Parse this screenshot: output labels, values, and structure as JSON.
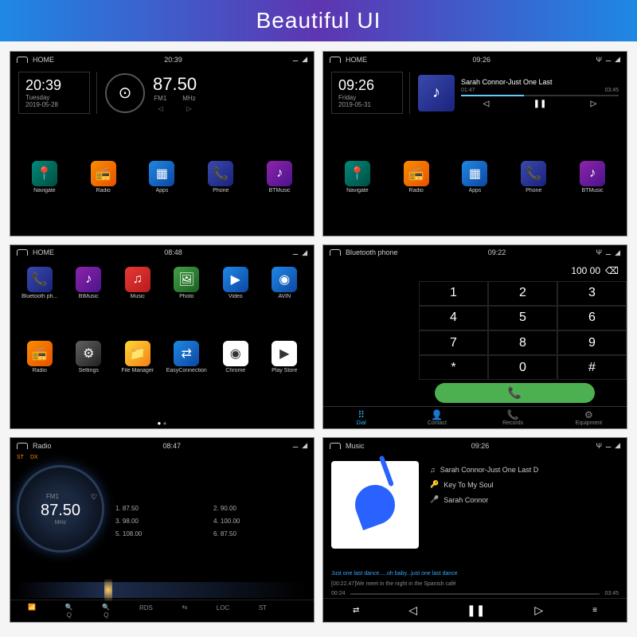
{
  "header": "Beautiful UI",
  "p1": {
    "bar_label": "HOME",
    "bar_time": "20:39",
    "clock": {
      "time": "20:39",
      "day": "Tuesday",
      "date": "2019-05-28"
    },
    "radio": {
      "freq": "87.50",
      "band": "FM1",
      "unit": "MHz"
    },
    "apps": [
      {
        "label": "Navigate",
        "icon": "📍",
        "cls": "teal"
      },
      {
        "label": "Radio",
        "icon": "📻",
        "cls": "orange"
      },
      {
        "label": "Apps",
        "icon": "▦",
        "cls": "blue"
      },
      {
        "label": "Phone",
        "icon": "📞",
        "cls": "navy"
      },
      {
        "label": "BTMusic",
        "icon": "♪",
        "cls": "purple"
      }
    ]
  },
  "p2": {
    "bar_label": "HOME",
    "bar_time": "09:26",
    "clock": {
      "time": "09:26",
      "day": "Friday",
      "date": "2019-05-31"
    },
    "music": {
      "title": "Sarah Connor-Just One Last",
      "t1": "01:47",
      "t2": "03:45"
    },
    "apps": [
      {
        "label": "Navigate",
        "icon": "📍",
        "cls": "teal"
      },
      {
        "label": "Radio",
        "icon": "📻",
        "cls": "orange"
      },
      {
        "label": "Apps",
        "icon": "▦",
        "cls": "blue"
      },
      {
        "label": "Phone",
        "icon": "📞",
        "cls": "navy"
      },
      {
        "label": "BTMusic",
        "icon": "♪",
        "cls": "purple"
      }
    ]
  },
  "p3": {
    "bar_label": "HOME",
    "bar_time": "08:48",
    "apps": [
      {
        "label": "Bluetooth ph...",
        "icon": "📞",
        "cls": "navy"
      },
      {
        "label": "BtMusic",
        "icon": "♪",
        "cls": "purple"
      },
      {
        "label": "Music",
        "icon": "♫",
        "cls": "red"
      },
      {
        "label": "Photo",
        "icon": "🖼",
        "cls": "green"
      },
      {
        "label": "Video",
        "icon": "▶",
        "cls": "blue"
      },
      {
        "label": "AVIN",
        "icon": "◉",
        "cls": "blue"
      },
      {
        "label": "Radio",
        "icon": "📻",
        "cls": "orange"
      },
      {
        "label": "Settings",
        "icon": "⚙",
        "cls": "grey"
      },
      {
        "label": "File Manager",
        "icon": "📁",
        "cls": "yellow"
      },
      {
        "label": "EasyConnection",
        "icon": "⇄",
        "cls": "blue"
      },
      {
        "label": "Chrome",
        "icon": "◉",
        "cls": "white"
      },
      {
        "label": "Play Store",
        "icon": "▶",
        "cls": "white"
      }
    ]
  },
  "p4": {
    "bar_label": "Bluetooth phone",
    "bar_time": "09:22",
    "display": "100 00",
    "keys": [
      "1",
      "2",
      "3",
      "4",
      "5",
      "6",
      "7",
      "8",
      "9",
      "*",
      "0",
      "#"
    ],
    "tabs": [
      {
        "label": "Dial",
        "icon": "⠿"
      },
      {
        "label": "Contact",
        "icon": "👤"
      },
      {
        "label": "Records",
        "icon": "📞"
      },
      {
        "label": "Equipment",
        "icon": "⚙"
      }
    ]
  },
  "p5": {
    "bar_label": "Radio",
    "bar_time": "08:47",
    "st": "ST",
    "dx": "DX",
    "band": "FM1",
    "freq": "87.50",
    "unit": "MHz",
    "presets": [
      {
        "n": "1.",
        "f": "87.50"
      },
      {
        "n": "2.",
        "f": "90.00"
      },
      {
        "n": "3.",
        "f": "98.00"
      },
      {
        "n": "4.",
        "f": "100.00"
      },
      {
        "n": "5.",
        "f": "108.00"
      },
      {
        "n": "6.",
        "f": "87.50"
      }
    ],
    "btns": [
      "",
      "Q",
      "Q",
      "RDS",
      "",
      "LOC",
      "ST",
      ""
    ]
  },
  "p6": {
    "bar_label": "Music",
    "bar_time": "09:26",
    "tracks": [
      {
        "icon": "♫",
        "label": "Sarah Connor-Just One Last D"
      },
      {
        "icon": "🔑",
        "label": "Key To My Soul"
      },
      {
        "icon": "🎤",
        "label": "Sarah Connor"
      }
    ],
    "lyrics1": "Just one last dance.....oh baby...just one last dance",
    "lyrics2": "[00:22.47]We meet in the night in the Spanish café",
    "t1": "00:24",
    "t2": "03:45"
  }
}
